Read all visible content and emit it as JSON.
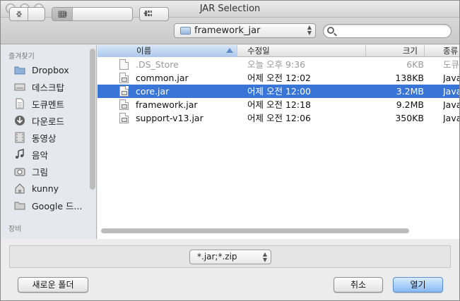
{
  "window": {
    "title": "JAR Selection"
  },
  "toolbar": {
    "path": "framework_jar",
    "search_placeholder": ""
  },
  "sidebar": {
    "sections": {
      "favorites": "즐겨찾기",
      "devices": "장비"
    },
    "items": [
      {
        "label": "Dropbox",
        "icon": "dropbox-icon"
      },
      {
        "label": "데스크탑",
        "icon": "desktop-icon"
      },
      {
        "label": "도큐멘트",
        "icon": "documents-icon"
      },
      {
        "label": "다운로드",
        "icon": "downloads-icon"
      },
      {
        "label": "동영상",
        "icon": "movies-icon"
      },
      {
        "label": "음악",
        "icon": "music-icon"
      },
      {
        "label": "그림",
        "icon": "pictures-icon"
      },
      {
        "label": "kunny",
        "icon": "home-icon"
      },
      {
        "label": "Google 드...",
        "icon": "folder-icon"
      }
    ]
  },
  "columns": {
    "name": "이름",
    "modified": "수정일",
    "size": "크기",
    "kind": "종류"
  },
  "files": [
    {
      "name": ".DS_Store",
      "modified": "오늘 오후 9:36",
      "size": "6KB",
      "kind": "도큐",
      "state": "hidden"
    },
    {
      "name": "common.jar",
      "modified": "어제 오전 12:02",
      "size": "138KB",
      "kind": "Java",
      "state": "normal"
    },
    {
      "name": "core.jar",
      "modified": "어제 오전 12:00",
      "size": "3.2MB",
      "kind": "Java",
      "state": "selected"
    },
    {
      "name": "framework.jar",
      "modified": "어제 오전 12:18",
      "size": "9.2MB",
      "kind": "Java",
      "state": "normal"
    },
    {
      "name": "support-v13.jar",
      "modified": "어제 오전 12:06",
      "size": "350KB",
      "kind": "Java",
      "state": "normal"
    }
  ],
  "filter": {
    "selected": "*.jar;*.zip"
  },
  "buttons": {
    "new_folder": "새로운 폴더",
    "cancel": "취소",
    "open": "열기"
  }
}
